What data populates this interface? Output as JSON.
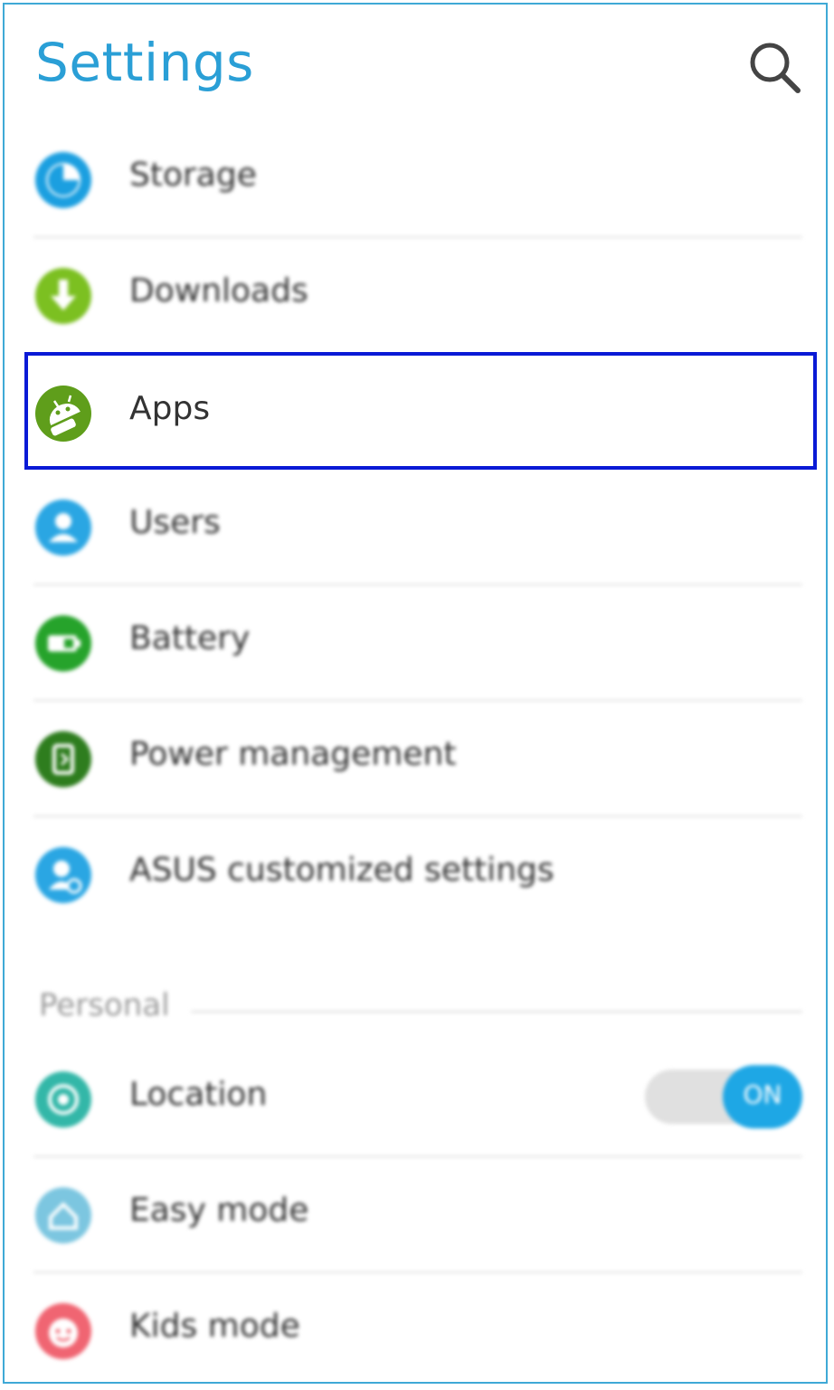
{
  "header": {
    "title": "Settings",
    "search_icon": "search-icon"
  },
  "items": [
    {
      "label": "Storage",
      "icon": "storage-icon",
      "color": "#1b9fe0"
    },
    {
      "label": "Downloads",
      "icon": "download-icon",
      "color": "#7cc021"
    },
    {
      "label": "Apps",
      "icon": "android-icon",
      "color": "#5f9e1b",
      "highlighted": true
    },
    {
      "label": "Users",
      "icon": "user-icon",
      "color": "#2aa6e3"
    },
    {
      "label": "Battery",
      "icon": "battery-icon",
      "color": "#26a32b"
    },
    {
      "label": "Power management",
      "icon": "power-management-icon",
      "color": "#2e7d1e"
    },
    {
      "label": "ASUS customized settings",
      "icon": "asus-settings-icon",
      "color": "#2aa6e3"
    }
  ],
  "personal": {
    "section_label": "Personal",
    "items": [
      {
        "label": "Location",
        "icon": "location-icon",
        "color": "#33b7a8",
        "toggle": "ON",
        "toggle_on": true
      },
      {
        "label": "Easy mode",
        "icon": "easy-mode-icon",
        "color": "#7cc6e0"
      },
      {
        "label": "Kids mode",
        "icon": "kids-mode-icon",
        "color": "#f06572"
      }
    ]
  },
  "colors": {
    "accent": "#2a9fd6",
    "highlight_border": "#0a1ad6",
    "toggle_on": "#1ea7e5"
  }
}
